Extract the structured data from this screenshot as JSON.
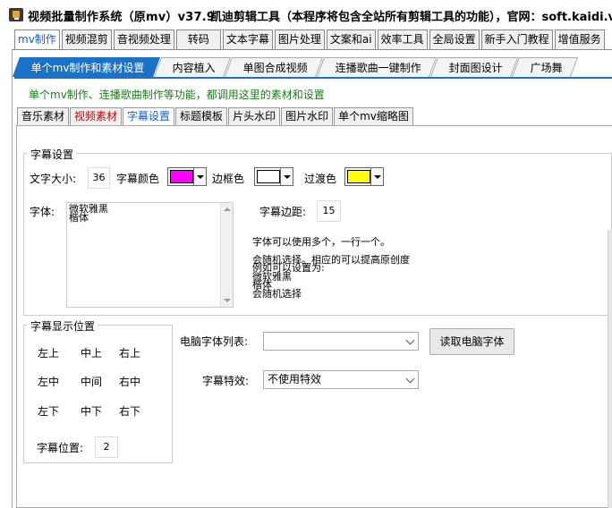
{
  "window": {
    "title": "视频批量制作系统（原mv）v37.9",
    "subtitle": "凯迪剪辑工具（本程序将包含全站所有剪辑工具的功能），官网：soft.kaidi.vip"
  },
  "main_tabs": [
    "mv制作",
    "视频混剪",
    "音视频处理",
    "转码",
    "文本字幕",
    "图片处理",
    "文案和ai",
    "效率工具",
    "全局设置",
    "新手入门教程",
    "增值服务"
  ],
  "sub_tabs": [
    "单个mv制作和素材设置",
    "内容植入",
    "单图合成视频",
    "连播歌曲一键制作",
    "封面图设计",
    "广场舞"
  ],
  "description": "单个mv制作、连播歌曲制作等功能，都调用这里的素材和设置",
  "material_tabs": [
    "音乐素材",
    "视频素材",
    "字幕设置",
    "标题模板",
    "片头水印",
    "图片水印",
    "单个mv缩略图"
  ],
  "subtitle_settings": {
    "group_title": "字幕设置",
    "font_size_label": "文字大小:",
    "font_size_value": "36",
    "color_label": "字幕颜色",
    "color_value": "#ff00ff",
    "border_label": "边框色",
    "border_value": "#ffffff",
    "transition_label": "过渡色",
    "transition_value": "#ffff00",
    "font_label": "字体:",
    "font_list": "微软雅黑\n楷体",
    "margin_label": "字幕边距:",
    "margin_value": "15",
    "help_line1": "字体可以使用多个，一行一个。",
    "help_line2": "会随机选择。相应的可以提高原创度\n例如可以设置为:\n微软雅黑\n楷体\n会随机选择"
  },
  "position": {
    "group_title": "字幕显示位置",
    "top_left": "左上",
    "top_center": "中上",
    "top_right": "右上",
    "mid_left": "左中",
    "mid_center": "中间",
    "mid_right": "右中",
    "bottom_left": "左下",
    "bottom_center": "中下",
    "bottom_right": "右下",
    "pos_label": "字幕位置:",
    "pos_value": "2"
  },
  "system_fonts": {
    "label": "电脑字体列表:",
    "value": "",
    "read_button": "读取电脑字体"
  },
  "effects": {
    "label": "字幕特效:",
    "value": "不使用特效"
  }
}
